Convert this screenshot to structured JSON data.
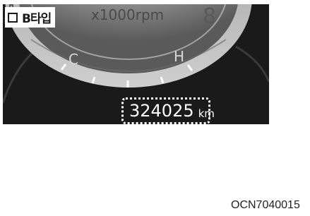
{
  "badge": {
    "label": "B타입"
  },
  "tachometer": {
    "unit_label": "x1000rpm",
    "digit": "8"
  },
  "temperature_gauge": {
    "cold_label": "C",
    "hot_label": "H"
  },
  "odometer": {
    "value": "324025",
    "unit": "km"
  },
  "figure_code": "OCN7040015",
  "colors": {
    "panel": "#1a1a1a",
    "highlight": "#ffffff"
  }
}
